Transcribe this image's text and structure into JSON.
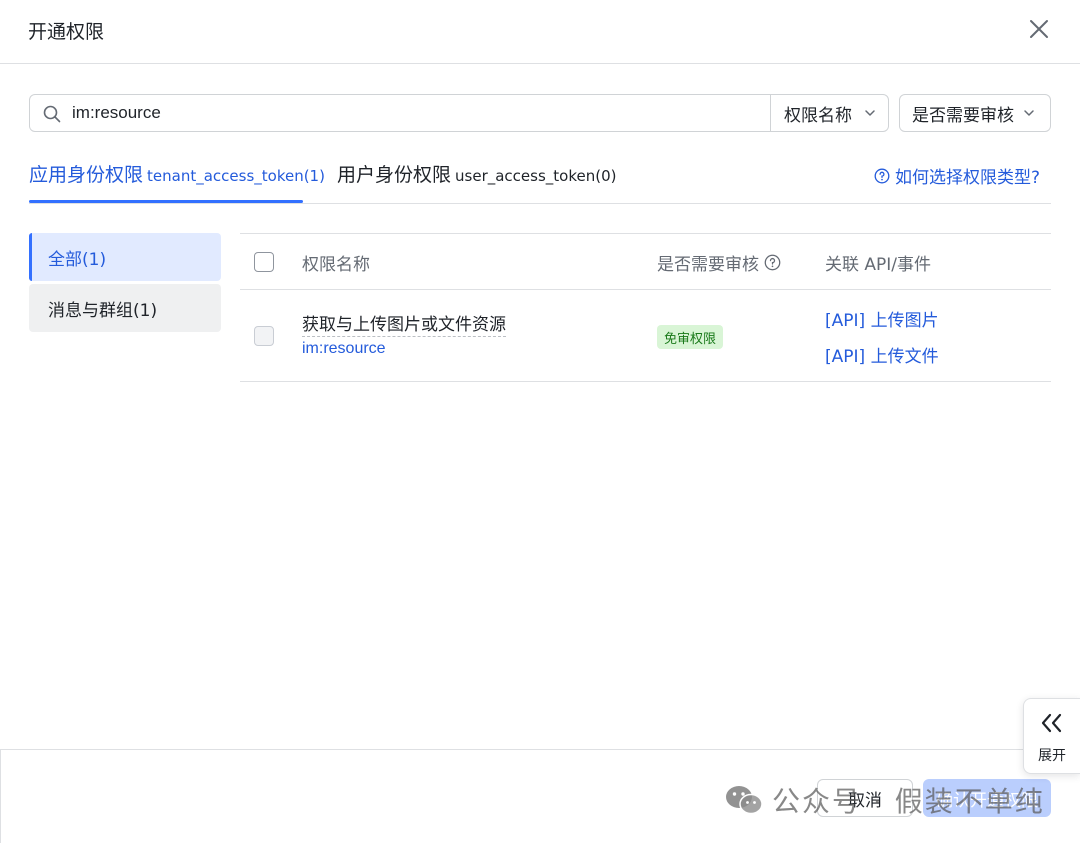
{
  "dialog": {
    "title": "开通权限"
  },
  "search": {
    "value": "im:resource",
    "field_select": "权限名称",
    "audit_select": "是否需要审核"
  },
  "tabs": [
    {
      "label": "应用身份权限",
      "token": "tenant_access_token(1)"
    },
    {
      "label": "用户身份权限",
      "token": "user_access_token(0)"
    }
  ],
  "help_link": "如何选择权限类型?",
  "categories": [
    {
      "label": "全部(1)"
    },
    {
      "label": "消息与群组(1)"
    }
  ],
  "table": {
    "headers": {
      "name": "权限名称",
      "audit": "是否需要审核",
      "api": "关联 API/事件"
    },
    "rows": [
      {
        "name": "获取与上传图片或文件资源",
        "code": "im:resource",
        "audit_badge": "免审权限",
        "apis": [
          "[API] 上传图片",
          "[API] 上传文件"
        ]
      }
    ]
  },
  "footer": {
    "cancel": "取消",
    "confirm": "确认开通权限"
  },
  "expand_panel": {
    "label": "展开"
  },
  "watermark": {
    "text": "公众号 · 假装不单纯"
  },
  "colors": {
    "accent": "#3370ff",
    "link": "#245bdb",
    "badge_bg": "#d9f5d6",
    "badge_text": "#1a7a1a",
    "confirm_disabled": "#bacefd"
  }
}
